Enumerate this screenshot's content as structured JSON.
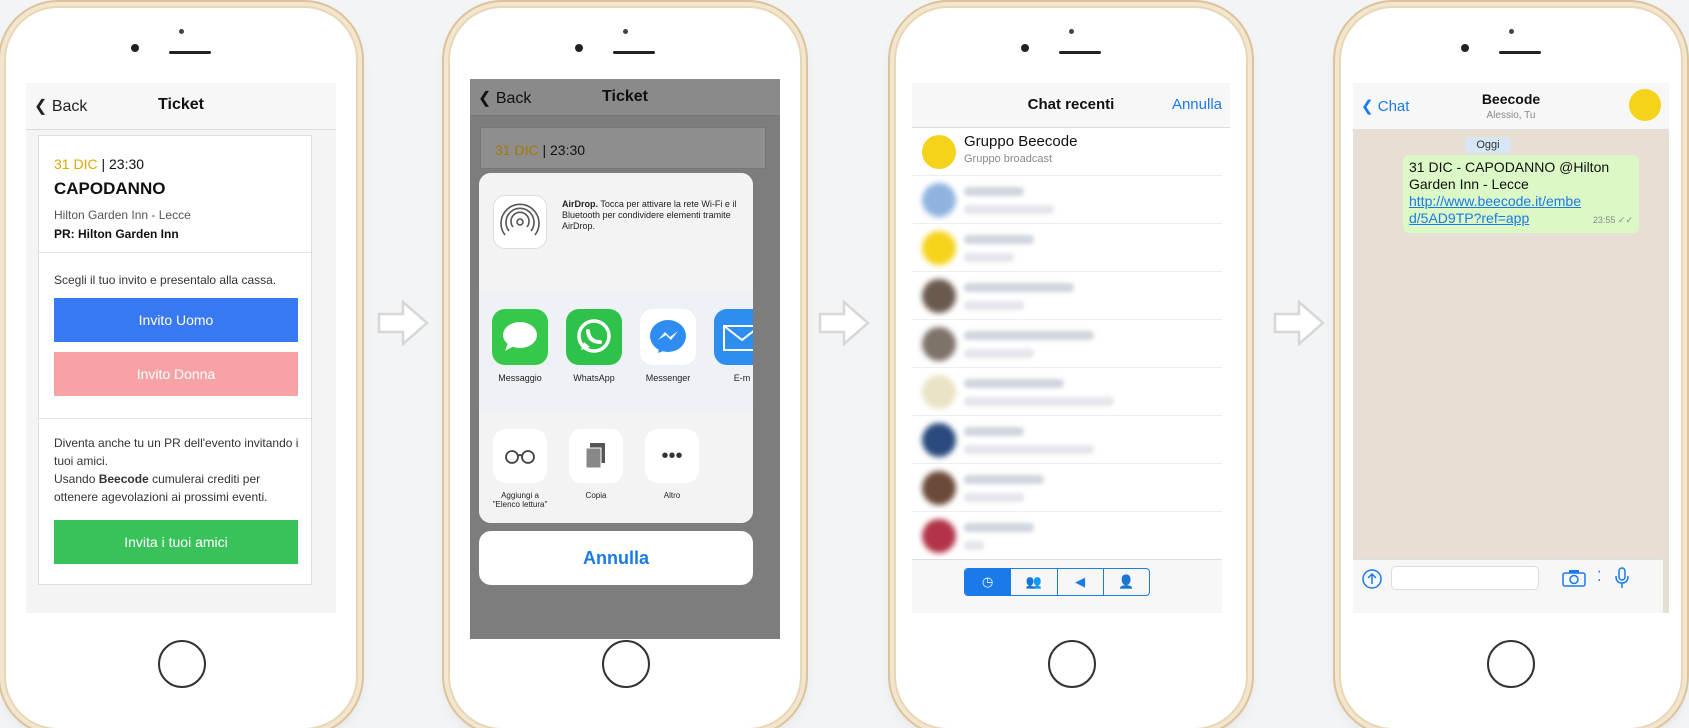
{
  "colors": {
    "accent": "#1a7ae8",
    "date_highlight": "#e0a800",
    "invite_man": "#3878f0",
    "invite_woman": "#f7a3a6",
    "invite_friends": "#39c25a",
    "whatsapp_bubble": "#dcf8c6"
  },
  "screen1": {
    "back_label": "Back",
    "title": "Ticket",
    "date_highlight": "31 DIC",
    "date_rest": " | 23:30",
    "event_name": "CAPODANNO",
    "location": "Hilton Garden Inn - Lecce",
    "pr": "PR: Hilton Garden Inn",
    "instruction": "Scegli il tuo invito e presentalo alla cassa.",
    "invite_man": "Invito Uomo",
    "invite_woman": "Invito Donna",
    "promo_line1": "Diventa anche tu un PR dell'evento invitando i tuoi amici.",
    "promo_line2_pre": "Usando ",
    "promo_brand": "Beecode",
    "promo_line2_post": " cumulerai crediti per ottenere agevolazioni ai prossimi eventi.",
    "invite_friends": "Invita i tuoi amici"
  },
  "screen2": {
    "back_label": "Back",
    "title": "Ticket",
    "date_highlight": "31 DIC",
    "date_rest": " | 23:30",
    "airdrop_title": "AirDrop.",
    "airdrop_text": " Tocca per attivare la rete Wi-Fi e il Bluetooth per condividere elementi tramite AirDrop.",
    "apps": [
      "Messaggio",
      "WhatsApp",
      "Messenger",
      "E-m"
    ],
    "actions": [
      "Aggiungi a \"Elenco lettura\"",
      "Copia",
      "Altro"
    ],
    "cancel": "Annulla"
  },
  "screen3": {
    "title": "Chat recenti",
    "cancel": "Annulla",
    "first_chat_name": "Gruppo Beecode",
    "first_chat_sub": "Gruppo broadcast"
  },
  "screen4": {
    "back_label": "Chat",
    "title": "Beecode",
    "subtitle": "Alessio, Tu",
    "day_label": "Oggi",
    "message_text": "31 DIC - CAPODANNO @Hilton Garden Inn - Lecce",
    "message_link": "http://www.beecode.it/embed/5AD9TP?ref=app",
    "message_time": "23:55 ✓✓"
  }
}
